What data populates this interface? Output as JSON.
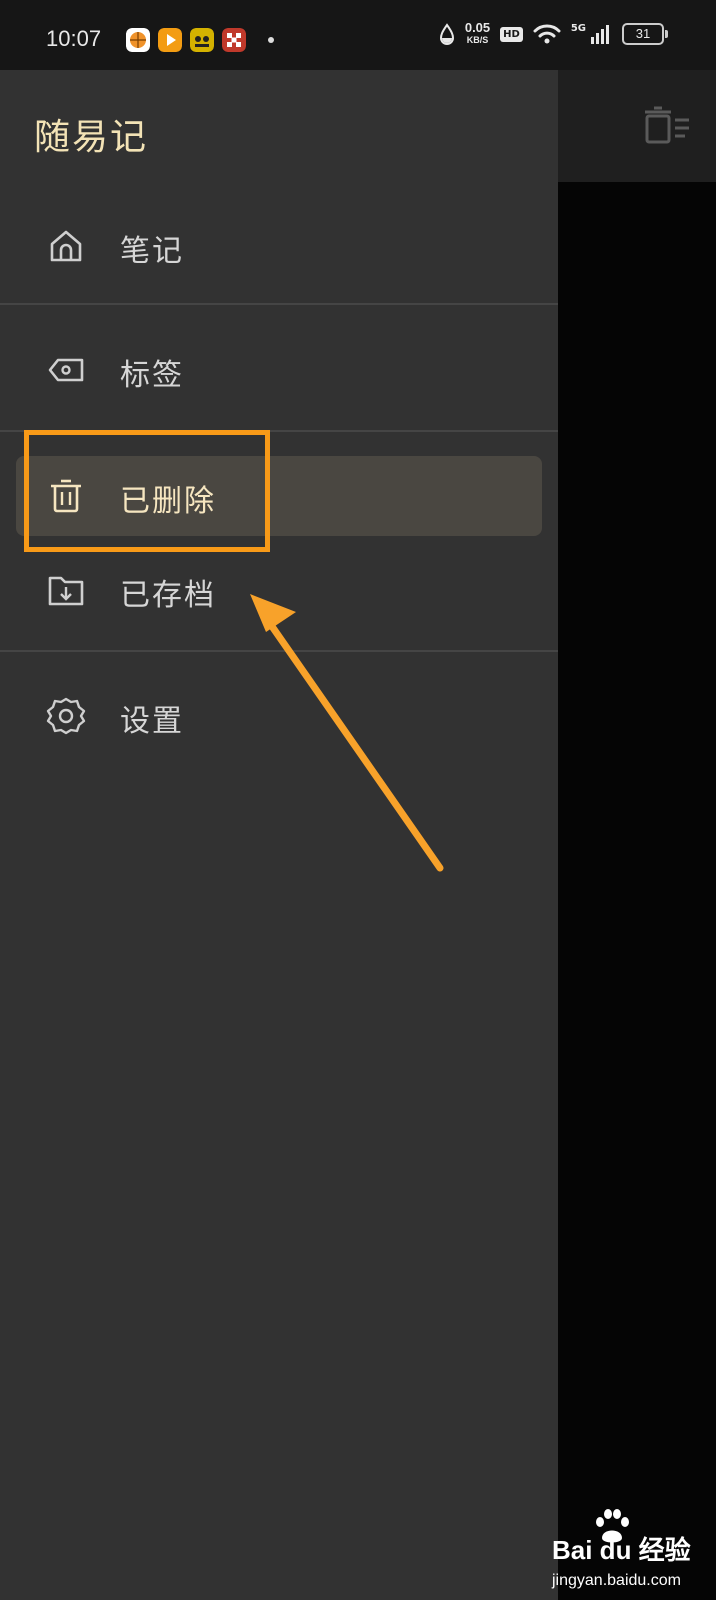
{
  "status_bar": {
    "time": "10:07",
    "net_speed": "0.05",
    "net_unit": "KB/S",
    "hd_label": "HD",
    "signal_label": "5G",
    "battery": "31",
    "icons": [
      "app-basketball-icon",
      "app-video-icon",
      "app-game-icon",
      "app-checker-icon",
      "notification-dot-icon",
      "data-drop-icon",
      "wifi-icon",
      "signal-icon",
      "battery-icon"
    ]
  },
  "drawer": {
    "title": "随易记",
    "items": [
      {
        "label": "笔记",
        "icon": "home-icon",
        "active": false
      },
      {
        "label": "标签",
        "icon": "tag-icon",
        "active": false
      },
      {
        "label": "已删除",
        "icon": "trash-icon",
        "active": true
      },
      {
        "label": "已存档",
        "icon": "archive-folder-icon",
        "active": false
      },
      {
        "label": "设置",
        "icon": "gear-icon",
        "active": false
      }
    ]
  },
  "background_app": {
    "toolbar_icon": "delete-list-icon"
  },
  "annotation": {
    "highlight_color": "#f89a18",
    "arrow_color": "#f8a22a"
  },
  "watermark": {
    "brand": "Bai du 经验",
    "url": "jingyan.baidu.com"
  },
  "colors": {
    "drawer_bg": "#323232",
    "accent_text": "#f3e3b6",
    "active_item_bg": "#4a4741"
  }
}
